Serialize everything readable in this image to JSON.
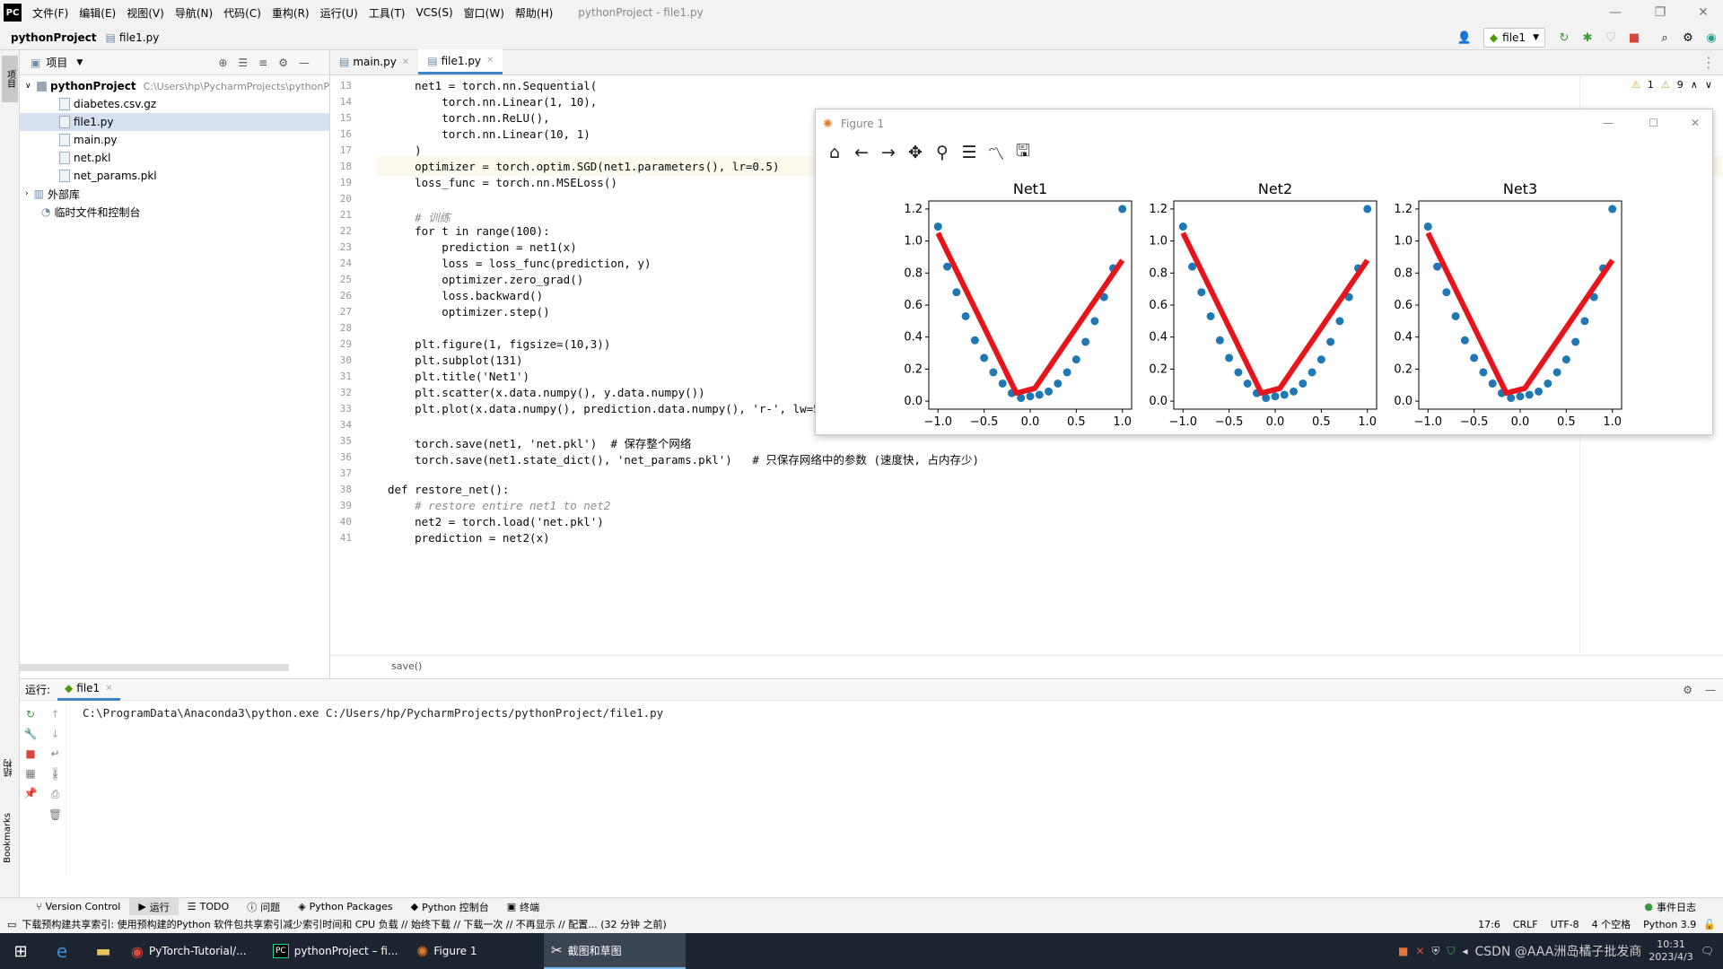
{
  "menubar": {
    "items": [
      "文件(F)",
      "编辑(E)",
      "视图(V)",
      "导航(N)",
      "代码(C)",
      "重构(R)",
      "运行(U)",
      "工具(T)",
      "VCS(S)",
      "窗口(W)",
      "帮助(H)"
    ],
    "title": "pythonProject - file1.py"
  },
  "navbar": {
    "project": "pythonProject",
    "file": "file1.py",
    "run_config": "file1"
  },
  "project_panel": {
    "header": "项目",
    "root": "pythonProject",
    "root_path": "C:\\Users\\hp\\PycharmProjects\\pythonP",
    "files": [
      "diabetes.csv.gz",
      "file1.py",
      "main.py",
      "net.pkl",
      "net_params.pkl"
    ],
    "external": "外部库",
    "scratch": "临时文件和控制台"
  },
  "editor": {
    "tabs": [
      "main.py",
      "file1.py"
    ],
    "inspection": {
      "warnings": "1",
      "weak": "9"
    },
    "lines": [
      {
        "n": "13",
        "code": "    net1 = torch.nn.Sequential("
      },
      {
        "n": "14",
        "code": "        torch.nn.Linear(1, 10),"
      },
      {
        "n": "15",
        "code": "        torch.nn.ReLU(),"
      },
      {
        "n": "16",
        "code": "        torch.nn.Linear(10, 1)"
      },
      {
        "n": "17",
        "code": "    )"
      },
      {
        "n": "18",
        "code": "    optimizer = torch.optim.SGD(net1.parameters(), lr=0.5)"
      },
      {
        "n": "19",
        "code": "    loss_func = torch.nn.MSELoss()"
      },
      {
        "n": "20",
        "code": ""
      },
      {
        "n": "21",
        "code": "    # 训练"
      },
      {
        "n": "22",
        "code": "    for t in range(100):"
      },
      {
        "n": "23",
        "code": "        prediction = net1(x)"
      },
      {
        "n": "24",
        "code": "        loss = loss_func(prediction, y)"
      },
      {
        "n": "25",
        "code": "        optimizer.zero_grad()"
      },
      {
        "n": "26",
        "code": "        loss.backward()"
      },
      {
        "n": "27",
        "code": "        optimizer.step()"
      },
      {
        "n": "28",
        "code": ""
      },
      {
        "n": "29",
        "code": "    plt.figure(1, figsize=(10,3))"
      },
      {
        "n": "30",
        "code": "    plt.subplot(131)"
      },
      {
        "n": "31",
        "code": "    plt.title('Net1')"
      },
      {
        "n": "32",
        "code": "    plt.scatter(x.data.numpy(), y.data.numpy())"
      },
      {
        "n": "33",
        "code": "    plt.plot(x.data.numpy(), prediction.data.numpy(), 'r-', lw=5)"
      },
      {
        "n": "34",
        "code": ""
      },
      {
        "n": "35",
        "code": "    torch.save(net1, 'net.pkl')  # 保存整个网络"
      },
      {
        "n": "36",
        "code": "    torch.save(net1.state_dict(), 'net_params.pkl')   # 只保存网络中的参数 (速度快, 占内存少)"
      },
      {
        "n": "37",
        "code": ""
      },
      {
        "n": "38",
        "code": "def restore_net():"
      },
      {
        "n": "39",
        "code": "    # restore entire net1 to net2"
      },
      {
        "n": "40",
        "code": "    net2 = torch.load('net.pkl')"
      },
      {
        "n": "41",
        "code": "    prediction = net2(x)"
      }
    ],
    "breadcrumb": "save()"
  },
  "figure": {
    "title": "Figure 1"
  },
  "chart_data": [
    {
      "type": "scatter",
      "title": "Net1",
      "xlim": [
        -1.1,
        1.1
      ],
      "ylim": [
        -0.05,
        1.25
      ],
      "xticks": [
        "−1.0",
        "−0.5",
        "0.0",
        "0.5",
        "1.0"
      ],
      "yticks": [
        "0.0",
        "0.2",
        "0.4",
        "0.6",
        "0.8",
        "1.0",
        "1.2"
      ],
      "series": [
        {
          "type": "scatter",
          "color": "#1f77b4",
          "x": [
            -1.0,
            -0.9,
            -0.8,
            -0.7,
            -0.6,
            -0.5,
            -0.4,
            -0.3,
            -0.2,
            -0.1,
            0.0,
            0.1,
            0.2,
            0.3,
            0.4,
            0.5,
            0.6,
            0.7,
            0.8,
            0.9,
            1.0
          ],
          "y": [
            1.09,
            0.84,
            0.68,
            0.53,
            0.38,
            0.27,
            0.18,
            0.11,
            0.05,
            0.02,
            0.03,
            0.04,
            0.06,
            0.11,
            0.18,
            0.26,
            0.37,
            0.5,
            0.65,
            0.83,
            1.2
          ]
        },
        {
          "type": "line",
          "color": "#e8141c",
          "x": [
            -1.0,
            -0.15,
            0.05,
            1.0
          ],
          "y": [
            1.05,
            0.05,
            0.08,
            0.88
          ]
        }
      ]
    },
    {
      "type": "scatter",
      "title": "Net2",
      "xlim": [
        -1.1,
        1.1
      ],
      "ylim": [
        -0.05,
        1.25
      ],
      "xticks": [
        "−1.0",
        "−0.5",
        "0.0",
        "0.5",
        "1.0"
      ],
      "yticks": [
        "0.0",
        "0.2",
        "0.4",
        "0.6",
        "0.8",
        "1.0",
        "1.2"
      ],
      "series": [
        {
          "type": "scatter",
          "color": "#1f77b4",
          "x": [
            -1.0,
            -0.9,
            -0.8,
            -0.7,
            -0.6,
            -0.5,
            -0.4,
            -0.3,
            -0.2,
            -0.1,
            0.0,
            0.1,
            0.2,
            0.3,
            0.4,
            0.5,
            0.6,
            0.7,
            0.8,
            0.9,
            1.0
          ],
          "y": [
            1.09,
            0.84,
            0.68,
            0.53,
            0.38,
            0.27,
            0.18,
            0.11,
            0.05,
            0.02,
            0.03,
            0.04,
            0.06,
            0.11,
            0.18,
            0.26,
            0.37,
            0.5,
            0.65,
            0.83,
            1.2
          ]
        },
        {
          "type": "line",
          "color": "#e8141c",
          "x": [
            -1.0,
            -0.15,
            0.05,
            1.0
          ],
          "y": [
            1.05,
            0.05,
            0.08,
            0.88
          ]
        }
      ]
    },
    {
      "type": "scatter",
      "title": "Net3",
      "xlim": [
        -1.1,
        1.1
      ],
      "ylim": [
        -0.05,
        1.25
      ],
      "xticks": [
        "−1.0",
        "−0.5",
        "0.0",
        "0.5",
        "1.0"
      ],
      "yticks": [
        "0.0",
        "0.2",
        "0.4",
        "0.6",
        "0.8",
        "1.0",
        "1.2"
      ],
      "series": [
        {
          "type": "scatter",
          "color": "#1f77b4",
          "x": [
            -1.0,
            -0.9,
            -0.8,
            -0.7,
            -0.6,
            -0.5,
            -0.4,
            -0.3,
            -0.2,
            -0.1,
            0.0,
            0.1,
            0.2,
            0.3,
            0.4,
            0.5,
            0.6,
            0.7,
            0.8,
            0.9,
            1.0
          ],
          "y": [
            1.09,
            0.84,
            0.68,
            0.53,
            0.38,
            0.27,
            0.18,
            0.11,
            0.05,
            0.02,
            0.03,
            0.04,
            0.06,
            0.11,
            0.18,
            0.26,
            0.37,
            0.5,
            0.65,
            0.83,
            1.2
          ]
        },
        {
          "type": "line",
          "color": "#e8141c",
          "x": [
            -1.0,
            -0.15,
            0.05,
            1.0
          ],
          "y": [
            1.05,
            0.05,
            0.08,
            0.88
          ]
        }
      ]
    }
  ],
  "run": {
    "label": "运行:",
    "tab": "file1",
    "output": "C:\\ProgramData\\Anaconda3\\python.exe C:/Users/hp/PycharmProjects/pythonProject/file1.py"
  },
  "bottom_tabs": [
    "Version Control",
    "运行",
    "TODO",
    "问题",
    "Python Packages",
    "Python 控制台",
    "终端"
  ],
  "event_log": "事件日志",
  "status": {
    "message": "下载预构建共享索引: 使用预构建的Python 软件包共享索引减少索引时间和 CPU 负载 // 始终下载 // 下载一次 // 不再显示 // 配置... (32 分钟 之前)",
    "position": "17:6",
    "line_sep": "CRLF",
    "encoding": "UTF-8",
    "indent": "4 个空格",
    "interpreter": "Python 3.9"
  },
  "taskbar": {
    "items": [
      "PyTorch-Tutorial/...",
      "pythonProject – fi...",
      "Figure 1",
      "截图和草图"
    ],
    "time": "10:31",
    "date": "2023/4/3",
    "watermark": "CSDN @AAA洲岛橘子批发商"
  },
  "side_labels": {
    "project": "项目",
    "structure": "结构",
    "bookmarks": "Bookmarks"
  },
  "colors": {
    "accent": "#4083c9",
    "scatter": "#1f77b4",
    "line": "#e8141c",
    "taskbar": "#1c2430"
  }
}
